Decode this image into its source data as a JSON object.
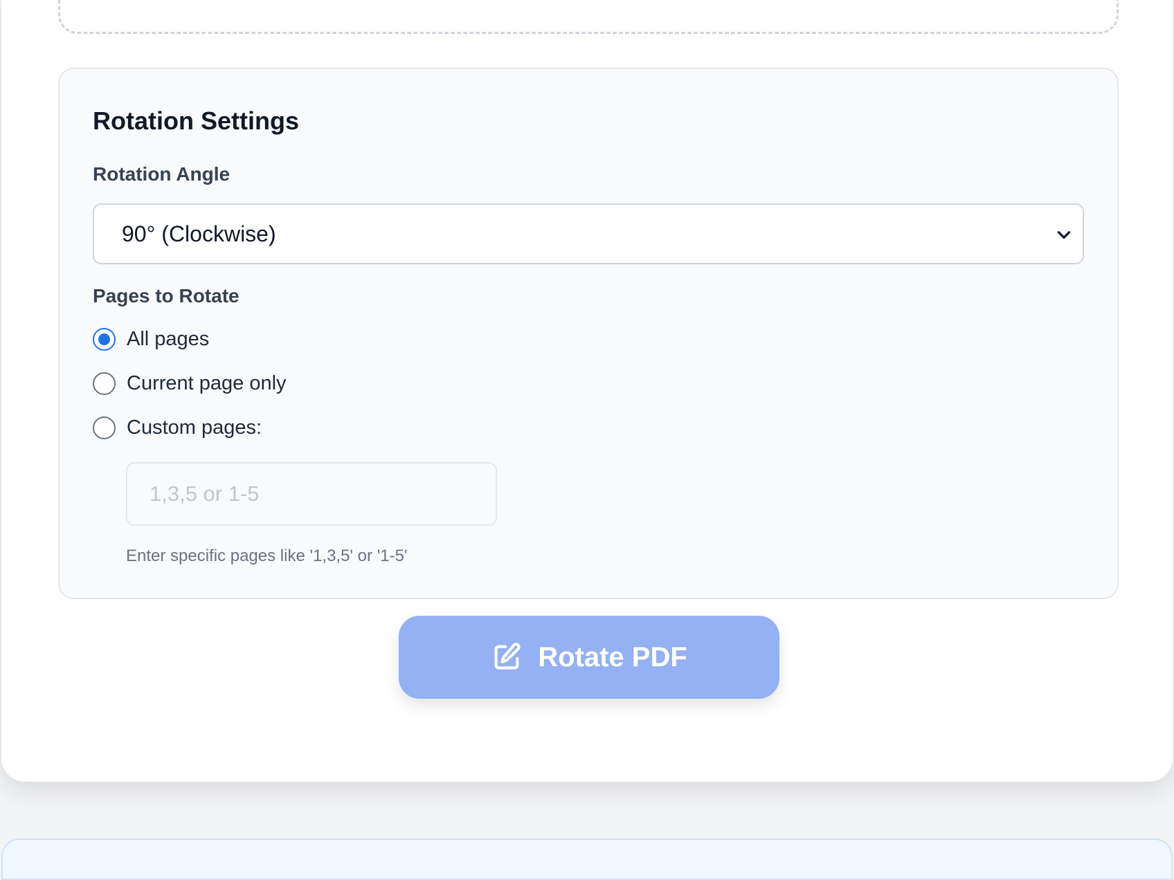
{
  "rotation_settings": {
    "title": "Rotation Settings",
    "angle_label": "Rotation Angle",
    "angle_selected": "90° (Clockwise)",
    "pages_label": "Pages to Rotate",
    "options": [
      {
        "label": "All pages",
        "checked": true
      },
      {
        "label": "Current page only",
        "checked": false
      },
      {
        "label": "Custom pages:",
        "checked": false
      }
    ],
    "custom_pages_placeholder": "1,3,5 or 1-5",
    "custom_pages_value": "",
    "custom_pages_help": "Enter specific pages like '1,3,5' or '1-5'"
  },
  "actions": {
    "rotate_label": "Rotate PDF",
    "rotate_icon": "edit-icon"
  },
  "colors": {
    "accent": "#1a73e8",
    "button_disabled": "#93b1f3"
  }
}
